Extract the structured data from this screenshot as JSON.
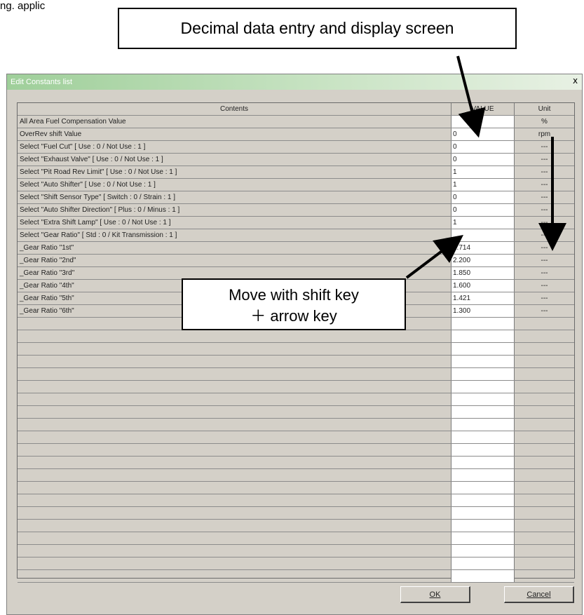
{
  "page_header": "ng. applic",
  "callouts": {
    "top": "Decimal data entry and display screen",
    "mid_line1": "Move with shift key",
    "mid_line2": "＋ arrow key"
  },
  "dialog": {
    "title": "Edit Constants list",
    "close_glyph": "x",
    "columns": {
      "contents": "Contents",
      "value": "VALUE",
      "unit": "Unit"
    },
    "rows": [
      {
        "contents": "All Area Fuel Compensation Value",
        "value": "",
        "unit": "%"
      },
      {
        "contents": "OverRev shift Value",
        "value": "0",
        "unit": "rpm"
      },
      {
        "contents": "Select \"Fuel Cut\" [ Use : 0 / Not Use : 1 ]",
        "value": "0",
        "unit": "---"
      },
      {
        "contents": "Select \"Exhaust Valve\" [ Use : 0 / Not Use : 1 ]",
        "value": "0",
        "unit": "---"
      },
      {
        "contents": "Select \"Pit Road Rev Limit\" [ Use : 0 / Not Use : 1 ]",
        "value": "1",
        "unit": "---"
      },
      {
        "contents": "Select \"Auto Shifter\" [ Use : 0 / Not Use : 1 ]",
        "value": "1",
        "unit": "---"
      },
      {
        "contents": "Select \"Shift Sensor Type\" [ Switch : 0 / Strain : 1 ]",
        "value": "0",
        "unit": "---"
      },
      {
        "contents": "Select \"Auto Shifter Direction\" [ Plus : 0 / Minus : 1 ]",
        "value": "0",
        "unit": "---"
      },
      {
        "contents": "Select \"Extra Shift Lamp\" [ Use : 0 / Not Use : 1 ]",
        "value": "1",
        "unit": "---"
      },
      {
        "contents": "Select \"Gear Ratio\" [ Std : 0 / Kit Transmission : 1 ]",
        "value": "",
        "unit": "---"
      },
      {
        "contents": "_Gear Ratio \"1st\"",
        "value": "2.714",
        "unit": "---"
      },
      {
        "contents": "_Gear Ratio \"2nd\"",
        "value": "2.200",
        "unit": "---"
      },
      {
        "contents": "_Gear Ratio \"3rd\"",
        "value": "1.850",
        "unit": "---"
      },
      {
        "contents": "_Gear Ratio \"4th\"",
        "value": "1.600",
        "unit": "---"
      },
      {
        "contents": "_Gear Ratio \"5th\"",
        "value": "1.421",
        "unit": "---"
      },
      {
        "contents": "_Gear Ratio \"6th\"",
        "value": "1.300",
        "unit": "---"
      }
    ],
    "empty_row_count": 21,
    "buttons": {
      "ok_label": "OK",
      "cancel_label": "Cancel"
    }
  }
}
